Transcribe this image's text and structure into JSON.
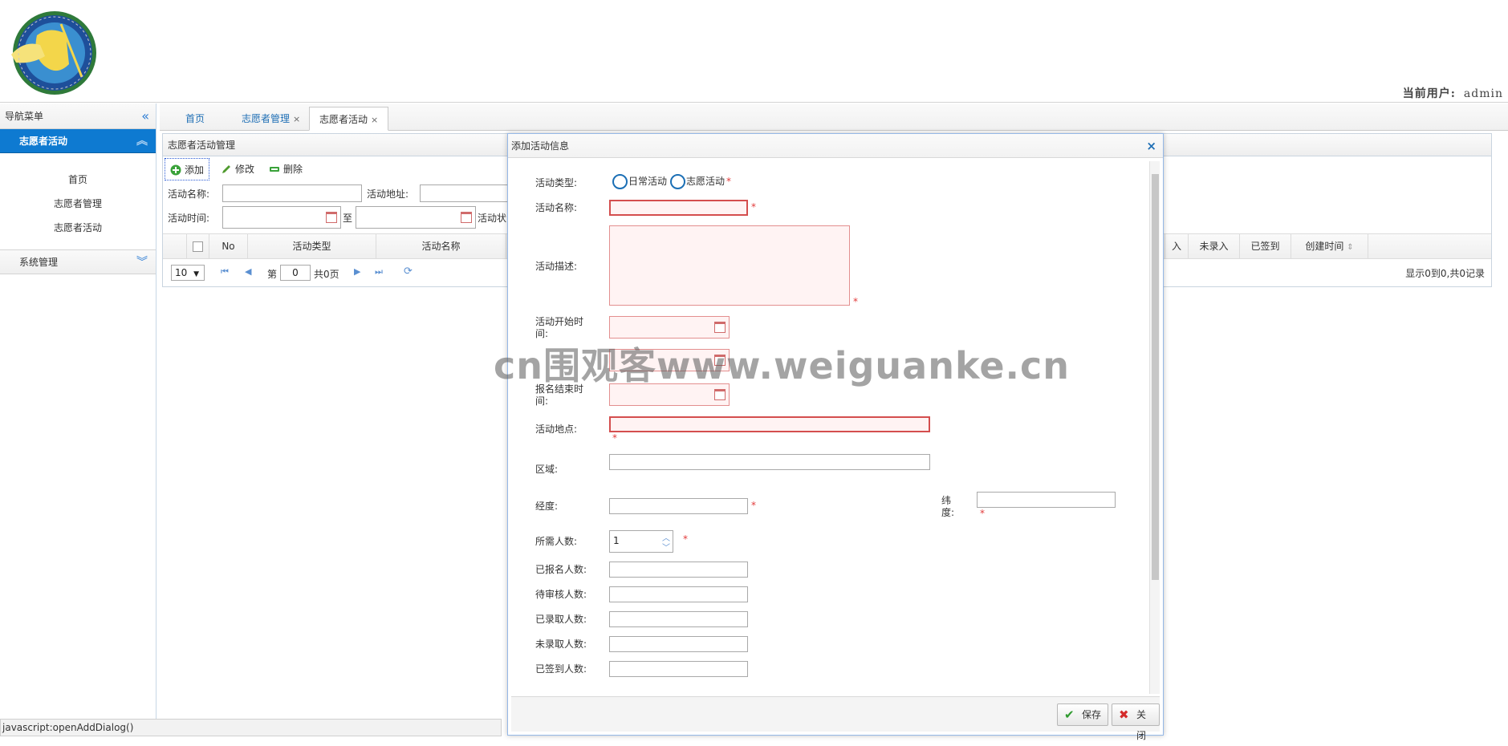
{
  "header": {
    "current_user_label": "当前用户:",
    "current_user": "admin"
  },
  "nav": {
    "title": "导航菜单",
    "active_group": "志愿者活动",
    "links": [
      "首页",
      "志愿者管理",
      "志愿者活动"
    ],
    "other_group": "系统管理"
  },
  "tabs": [
    {
      "label": "首页",
      "closable": false
    },
    {
      "label": "志愿者管理",
      "closable": true
    },
    {
      "label": "志愿者活动",
      "closable": true,
      "active": true
    }
  ],
  "panel": {
    "title": "志愿者活动管理",
    "toolbar": {
      "add": "添加",
      "edit": "修改",
      "delete": "删除"
    },
    "search": {
      "name_label": "活动名称:",
      "address_label": "活动地址:",
      "time_label": "活动时间:",
      "to_label": "至",
      "status_label": "活动状"
    },
    "columns": {
      "no": "No",
      "type": "活动类型",
      "name": "活动名称",
      "enrolled_partial": "入",
      "not_enrolled": "未录入",
      "signed": "已签到",
      "created": "创建时间"
    },
    "pager": {
      "page_size": "10",
      "page_prefix": "第",
      "page_value": "0",
      "page_total": "共0页",
      "info": "显示0到0,共0记录"
    }
  },
  "dialog": {
    "title": "添加活动信息",
    "type_label": "活动类型:",
    "type_options": [
      "日常活动",
      "志愿活动"
    ],
    "name_label": "活动名称:",
    "desc_label": "活动描述:",
    "start_label": "活动开始时间:",
    "signup_end_label": "报名结束时间:",
    "address_label": "活动地点:",
    "region_label": "区域:",
    "lng_label": "经度:",
    "lat_label": "纬度:",
    "needed_label": "所需人数:",
    "needed_value": "1",
    "signed_up_label": "已报名人数:",
    "pending_label": "待审核人数:",
    "admitted_label": "已录取人数:",
    "not_admitted_label": "未录取人数:",
    "checked_in_label": "已签到人数:",
    "required_mark": "*",
    "save": "保存",
    "close": "关闭"
  },
  "watermark": "cn围观客www.weiguanke.cn",
  "statusbar": "javascript:openAddDialog()",
  "colors": {
    "accent": "#0e7ad1",
    "required": "#e23b3b",
    "dialog_border": "#95b8e7"
  }
}
